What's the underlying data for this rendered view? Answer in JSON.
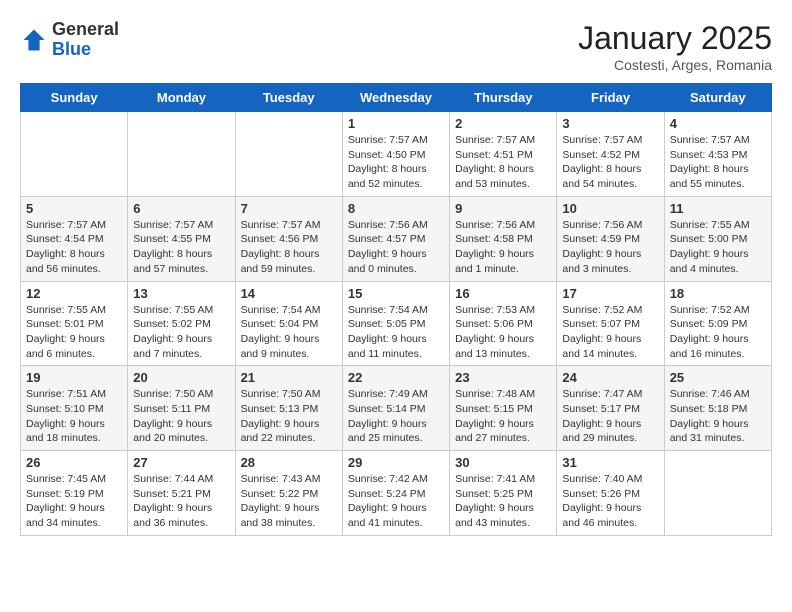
{
  "logo": {
    "general": "General",
    "blue": "Blue"
  },
  "header": {
    "month": "January 2025",
    "location": "Costesti, Arges, Romania"
  },
  "weekdays": [
    "Sunday",
    "Monday",
    "Tuesday",
    "Wednesday",
    "Thursday",
    "Friday",
    "Saturday"
  ],
  "weeks": [
    [
      {
        "day": "",
        "info": ""
      },
      {
        "day": "",
        "info": ""
      },
      {
        "day": "",
        "info": ""
      },
      {
        "day": "1",
        "info": "Sunrise: 7:57 AM\nSunset: 4:50 PM\nDaylight: 8 hours\nand 52 minutes."
      },
      {
        "day": "2",
        "info": "Sunrise: 7:57 AM\nSunset: 4:51 PM\nDaylight: 8 hours\nand 53 minutes."
      },
      {
        "day": "3",
        "info": "Sunrise: 7:57 AM\nSunset: 4:52 PM\nDaylight: 8 hours\nand 54 minutes."
      },
      {
        "day": "4",
        "info": "Sunrise: 7:57 AM\nSunset: 4:53 PM\nDaylight: 8 hours\nand 55 minutes."
      }
    ],
    [
      {
        "day": "5",
        "info": "Sunrise: 7:57 AM\nSunset: 4:54 PM\nDaylight: 8 hours\nand 56 minutes."
      },
      {
        "day": "6",
        "info": "Sunrise: 7:57 AM\nSunset: 4:55 PM\nDaylight: 8 hours\nand 57 minutes."
      },
      {
        "day": "7",
        "info": "Sunrise: 7:57 AM\nSunset: 4:56 PM\nDaylight: 8 hours\nand 59 minutes."
      },
      {
        "day": "8",
        "info": "Sunrise: 7:56 AM\nSunset: 4:57 PM\nDaylight: 9 hours\nand 0 minutes."
      },
      {
        "day": "9",
        "info": "Sunrise: 7:56 AM\nSunset: 4:58 PM\nDaylight: 9 hours\nand 1 minute."
      },
      {
        "day": "10",
        "info": "Sunrise: 7:56 AM\nSunset: 4:59 PM\nDaylight: 9 hours\nand 3 minutes."
      },
      {
        "day": "11",
        "info": "Sunrise: 7:55 AM\nSunset: 5:00 PM\nDaylight: 9 hours\nand 4 minutes."
      }
    ],
    [
      {
        "day": "12",
        "info": "Sunrise: 7:55 AM\nSunset: 5:01 PM\nDaylight: 9 hours\nand 6 minutes."
      },
      {
        "day": "13",
        "info": "Sunrise: 7:55 AM\nSunset: 5:02 PM\nDaylight: 9 hours\nand 7 minutes."
      },
      {
        "day": "14",
        "info": "Sunrise: 7:54 AM\nSunset: 5:04 PM\nDaylight: 9 hours\nand 9 minutes."
      },
      {
        "day": "15",
        "info": "Sunrise: 7:54 AM\nSunset: 5:05 PM\nDaylight: 9 hours\nand 11 minutes."
      },
      {
        "day": "16",
        "info": "Sunrise: 7:53 AM\nSunset: 5:06 PM\nDaylight: 9 hours\nand 13 minutes."
      },
      {
        "day": "17",
        "info": "Sunrise: 7:52 AM\nSunset: 5:07 PM\nDaylight: 9 hours\nand 14 minutes."
      },
      {
        "day": "18",
        "info": "Sunrise: 7:52 AM\nSunset: 5:09 PM\nDaylight: 9 hours\nand 16 minutes."
      }
    ],
    [
      {
        "day": "19",
        "info": "Sunrise: 7:51 AM\nSunset: 5:10 PM\nDaylight: 9 hours\nand 18 minutes."
      },
      {
        "day": "20",
        "info": "Sunrise: 7:50 AM\nSunset: 5:11 PM\nDaylight: 9 hours\nand 20 minutes."
      },
      {
        "day": "21",
        "info": "Sunrise: 7:50 AM\nSunset: 5:13 PM\nDaylight: 9 hours\nand 22 minutes."
      },
      {
        "day": "22",
        "info": "Sunrise: 7:49 AM\nSunset: 5:14 PM\nDaylight: 9 hours\nand 25 minutes."
      },
      {
        "day": "23",
        "info": "Sunrise: 7:48 AM\nSunset: 5:15 PM\nDaylight: 9 hours\nand 27 minutes."
      },
      {
        "day": "24",
        "info": "Sunrise: 7:47 AM\nSunset: 5:17 PM\nDaylight: 9 hours\nand 29 minutes."
      },
      {
        "day": "25",
        "info": "Sunrise: 7:46 AM\nSunset: 5:18 PM\nDaylight: 9 hours\nand 31 minutes."
      }
    ],
    [
      {
        "day": "26",
        "info": "Sunrise: 7:45 AM\nSunset: 5:19 PM\nDaylight: 9 hours\nand 34 minutes."
      },
      {
        "day": "27",
        "info": "Sunrise: 7:44 AM\nSunset: 5:21 PM\nDaylight: 9 hours\nand 36 minutes."
      },
      {
        "day": "28",
        "info": "Sunrise: 7:43 AM\nSunset: 5:22 PM\nDaylight: 9 hours\nand 38 minutes."
      },
      {
        "day": "29",
        "info": "Sunrise: 7:42 AM\nSunset: 5:24 PM\nDaylight: 9 hours\nand 41 minutes."
      },
      {
        "day": "30",
        "info": "Sunrise: 7:41 AM\nSunset: 5:25 PM\nDaylight: 9 hours\nand 43 minutes."
      },
      {
        "day": "31",
        "info": "Sunrise: 7:40 AM\nSunset: 5:26 PM\nDaylight: 9 hours\nand 46 minutes."
      },
      {
        "day": "",
        "info": ""
      }
    ]
  ]
}
